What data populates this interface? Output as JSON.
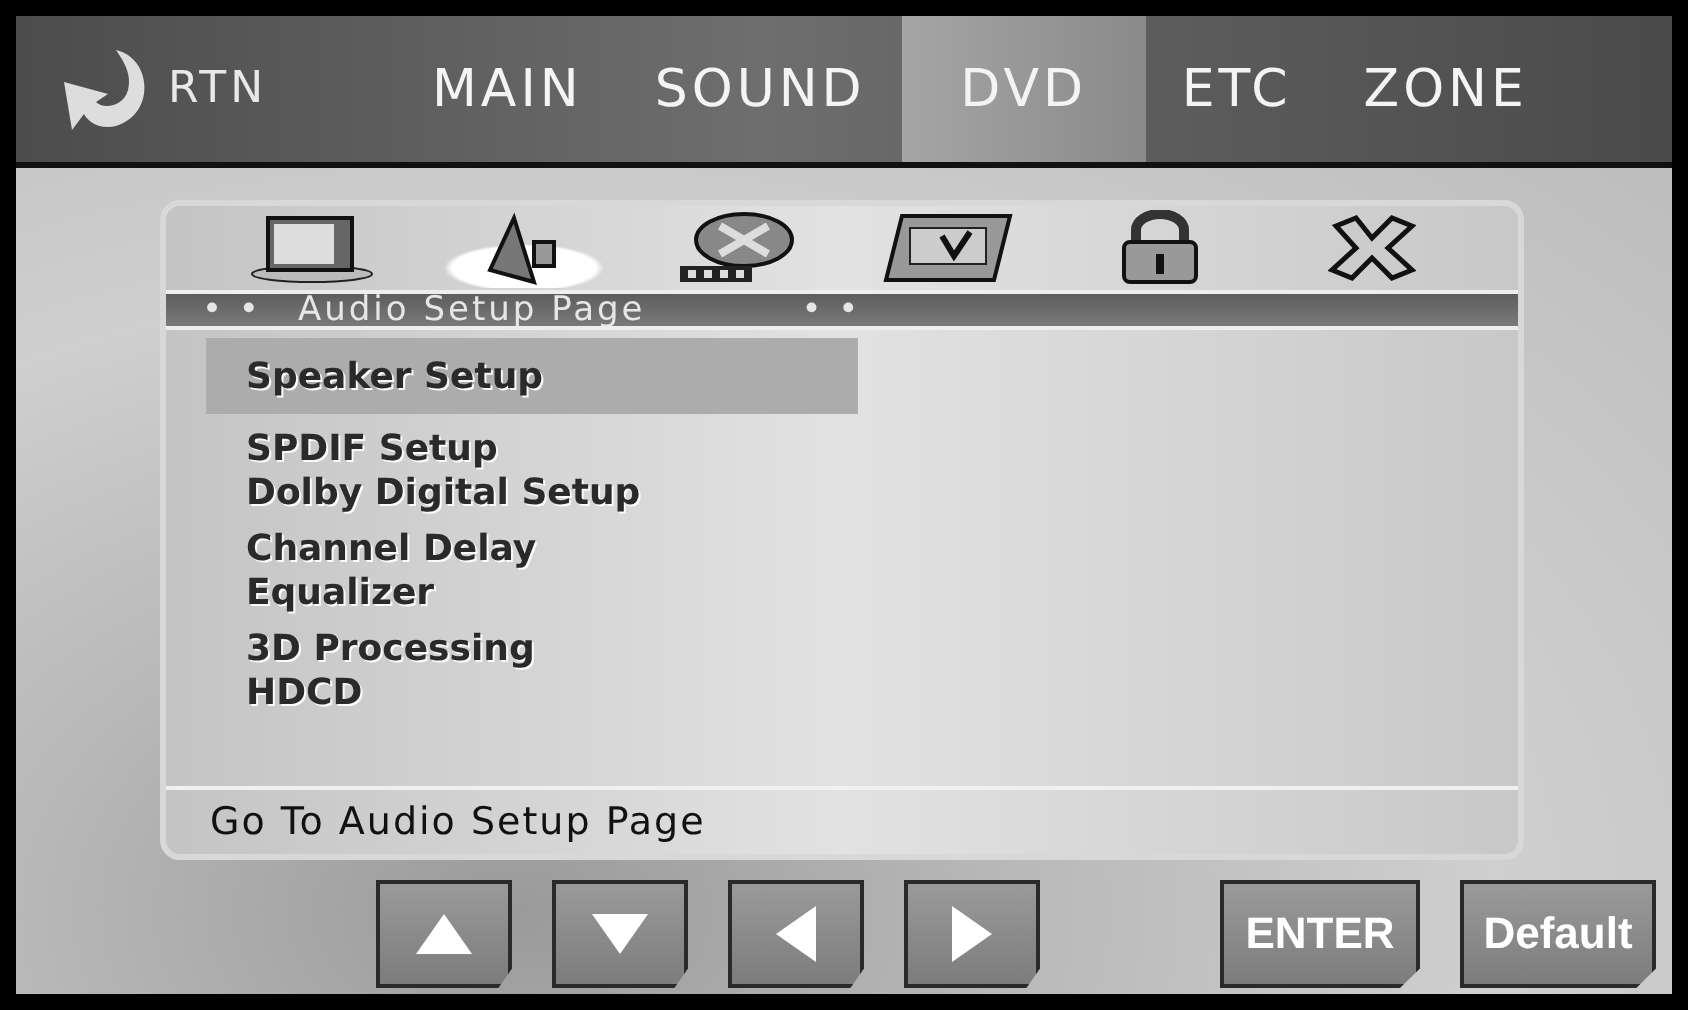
{
  "top_nav": {
    "back_label": "RTN",
    "tabs": [
      {
        "label": "MAIN",
        "selected": false
      },
      {
        "label": "SOUND",
        "selected": false
      },
      {
        "label": "DVD",
        "selected": true
      },
      {
        "label": "ETC",
        "selected": false
      },
      {
        "label": "ZONE",
        "selected": false
      }
    ]
  },
  "setup_icons": [
    {
      "kind": "tv",
      "selected": false
    },
    {
      "kind": "speaker",
      "selected": true
    },
    {
      "kind": "film",
      "selected": false
    },
    {
      "kind": "panel",
      "selected": false
    },
    {
      "kind": "lock",
      "selected": false
    },
    {
      "kind": "exit",
      "selected": false
    }
  ],
  "page_title": {
    "left_marker": "• •",
    "text": "Audio Setup Page",
    "right_marker": "• •"
  },
  "menu_groups": [
    [
      {
        "label": "Speaker Setup",
        "selected": true
      }
    ],
    [
      {
        "label": "SPDIF Setup",
        "selected": false
      },
      {
        "label": "Dolby Digital Setup",
        "selected": false
      }
    ],
    [
      {
        "label": "Channel Delay",
        "selected": false
      },
      {
        "label": "Equalizer",
        "selected": false
      }
    ],
    [
      {
        "label": "3D Processing",
        "selected": false
      },
      {
        "label": "HDCD",
        "selected": false
      }
    ]
  ],
  "status_text": "Go To Audio Setup Page",
  "buttons": [
    {
      "kind": "up"
    },
    {
      "kind": "down"
    },
    {
      "kind": "left"
    },
    {
      "kind": "right"
    },
    {
      "kind": "text",
      "label": "ENTER"
    },
    {
      "kind": "text",
      "label": "Default"
    }
  ]
}
